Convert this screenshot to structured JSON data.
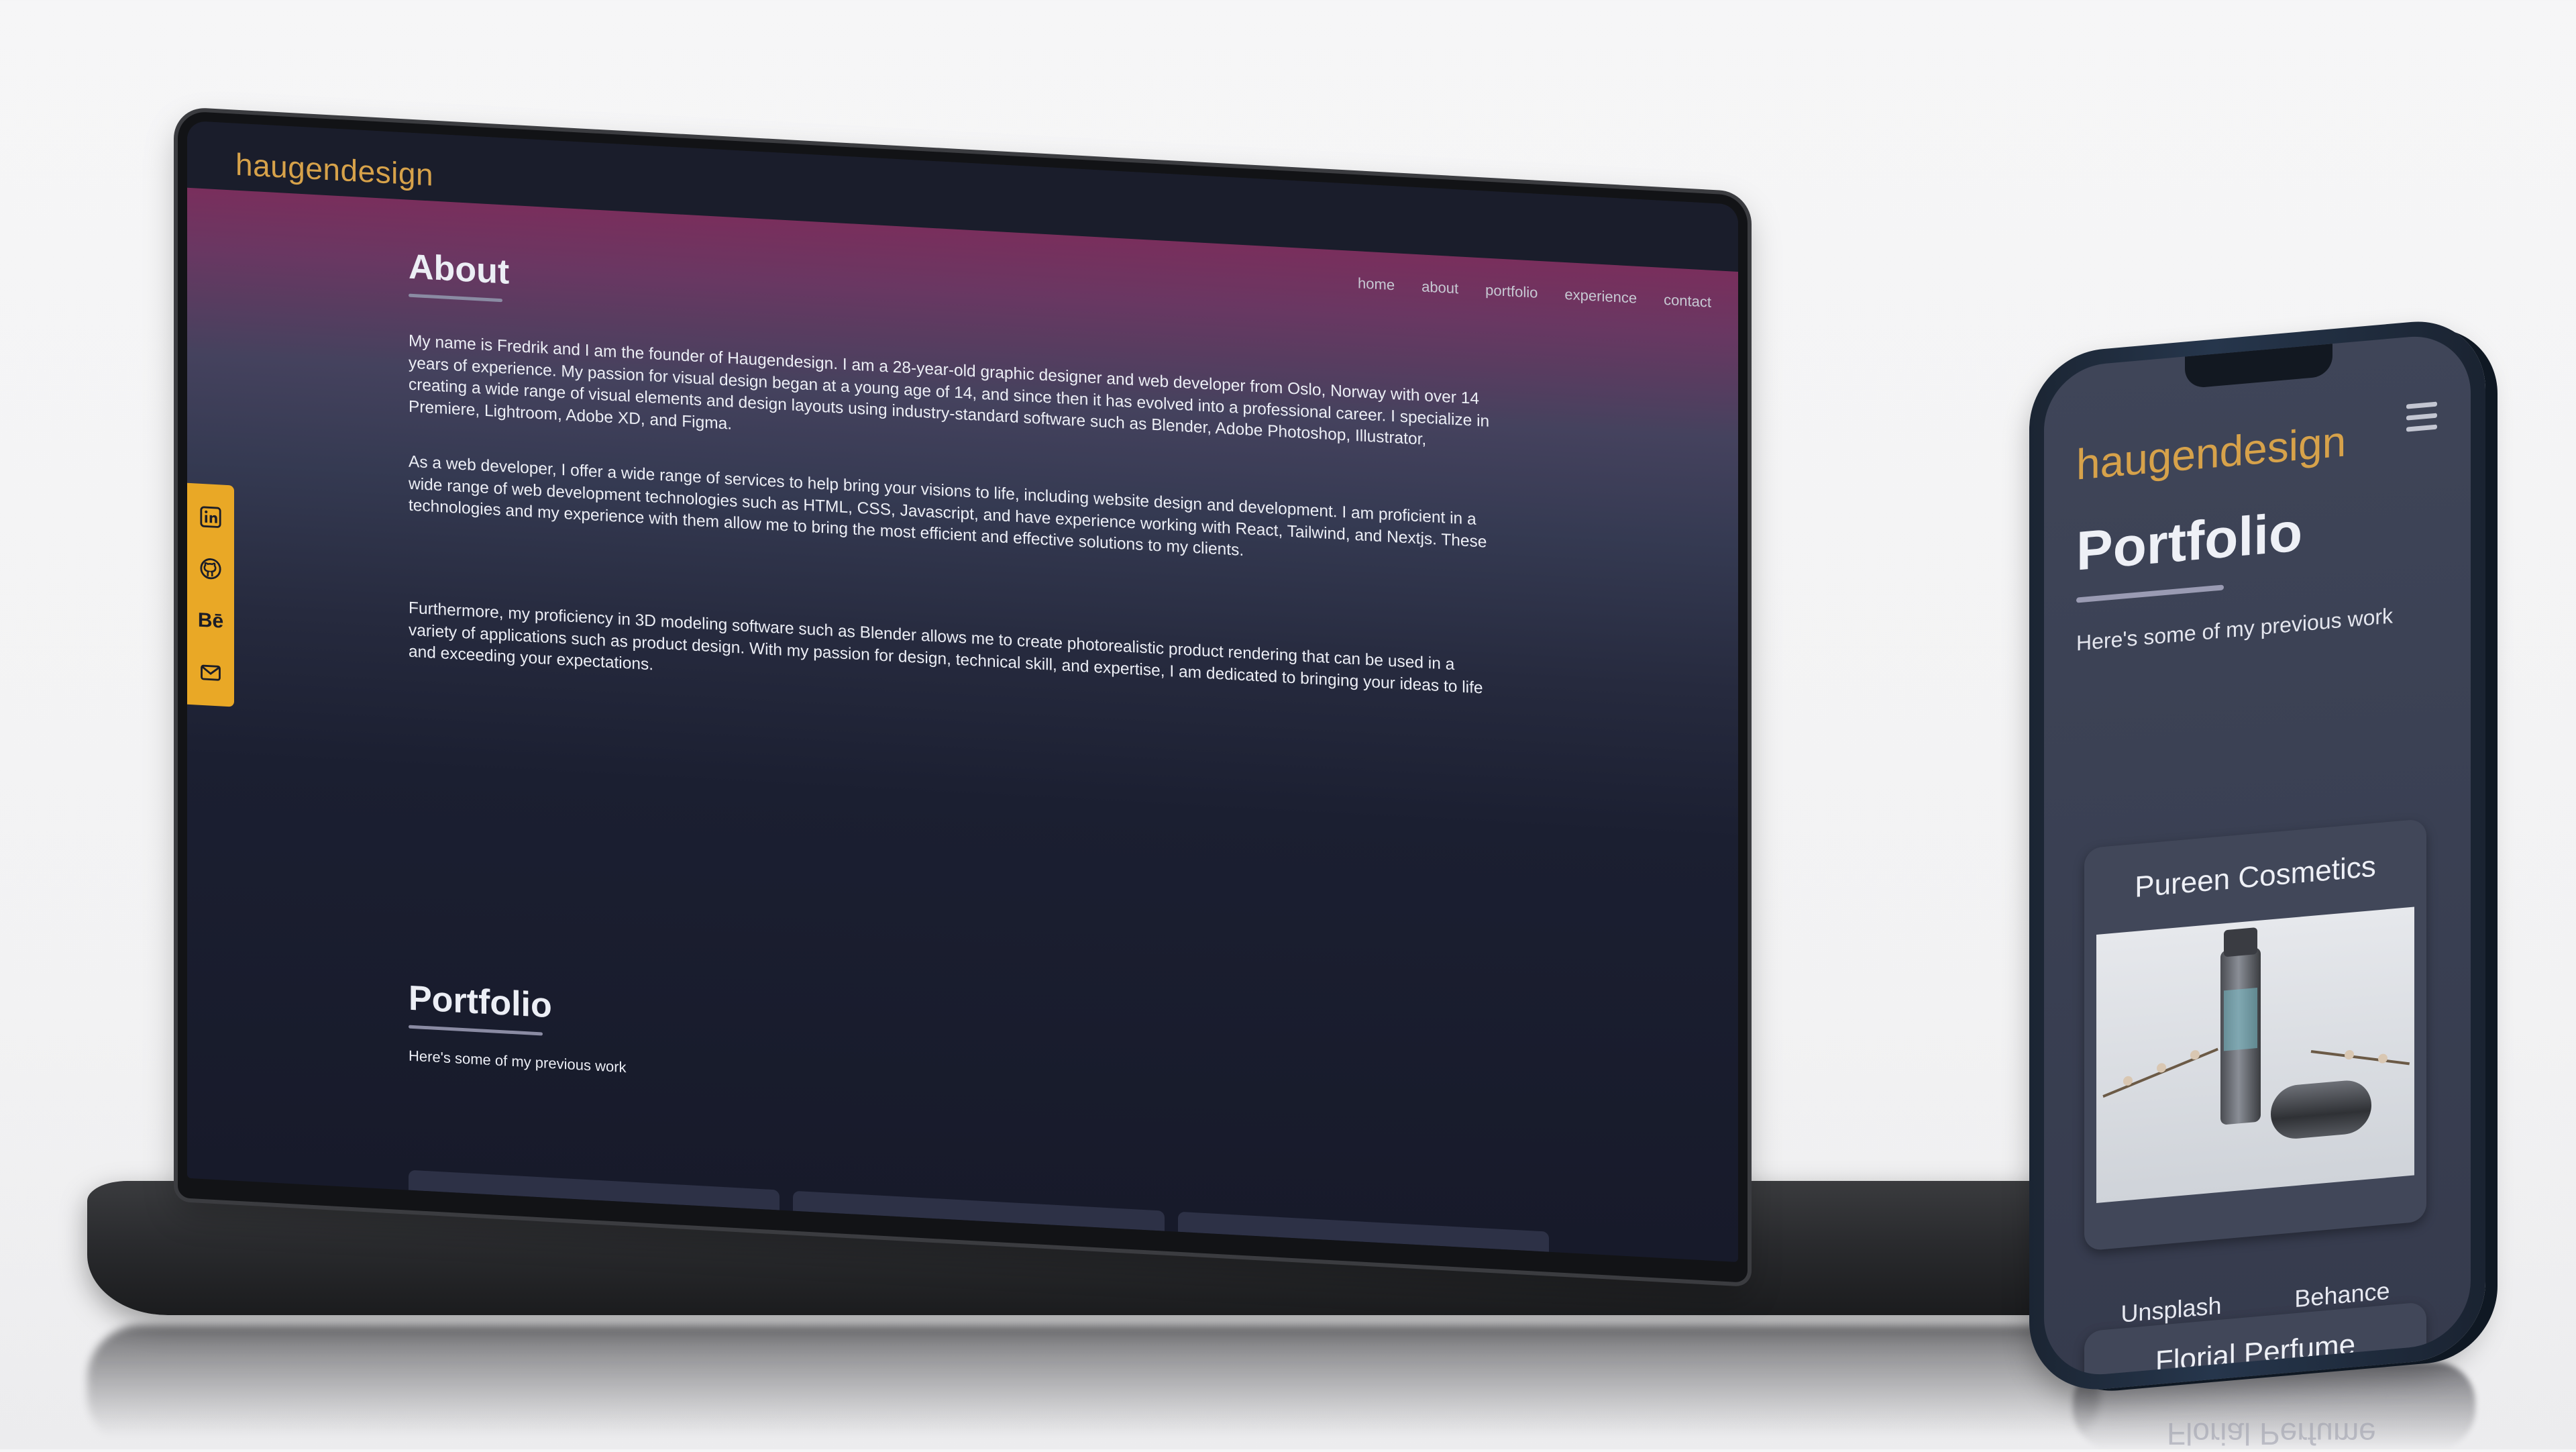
{
  "laptop": {
    "logo": "haugendesign",
    "nav": [
      "home",
      "about",
      "portfolio",
      "experience",
      "contact"
    ],
    "social_icons": [
      "linkedin-icon",
      "github-icon",
      "behance-icon",
      "mail-icon"
    ],
    "about_heading": "About",
    "paragraphs": [
      "My name is Fredrik and I am the founder of Haugendesign. I am a 28-year-old graphic designer and web developer from Oslo, Norway with over 14 years of experience. My passion for visual design began at a young age of 14, and since then it has evolved into a professional career. I specialize in creating a wide range of visual elements and design layouts using industry-standard software such as Blender, Adobe Photoshop, Illustrator, Premiere, Lightroom, Adobe XD, and Figma.",
      "As a web developer, I offer a wide range of services to help bring your visions to life, including website design and development. I am proficient in a wide range of web development technologies such as HTML, CSS, Javascript, and have experience working with React, Tailwind, and Nextjs. These technologies and my experience with them allow me to bring the most efficient and effective solutions to my clients.",
      "Furthermore, my proficiency in 3D modeling software such as Blender allows me to create photorealistic product rendering that can be used in a variety of applications such as product design. With my passion for design, technical skill, and expertise, I am dedicated to bringing your ideas to life and exceeding your expectations."
    ],
    "portfolio_heading": "Portfolio",
    "portfolio_sub": "Here's some of my previous work"
  },
  "phone": {
    "logo": "haugendesign",
    "menu_icon": "hamburger-menu-icon",
    "portfolio_heading": "Portfolio",
    "portfolio_sub": "Here's some of my previous work",
    "cards": [
      {
        "title": "Pureen Cosmetics",
        "links": [
          "Unsplash",
          "Behance"
        ]
      },
      {
        "title": "Florial Perfume"
      }
    ]
  },
  "colors": {
    "accent": "#e9a826",
    "logo": "#d7a24a",
    "background_dark": "#1a1d2b",
    "gradient_pink": "#7a2e5c"
  }
}
